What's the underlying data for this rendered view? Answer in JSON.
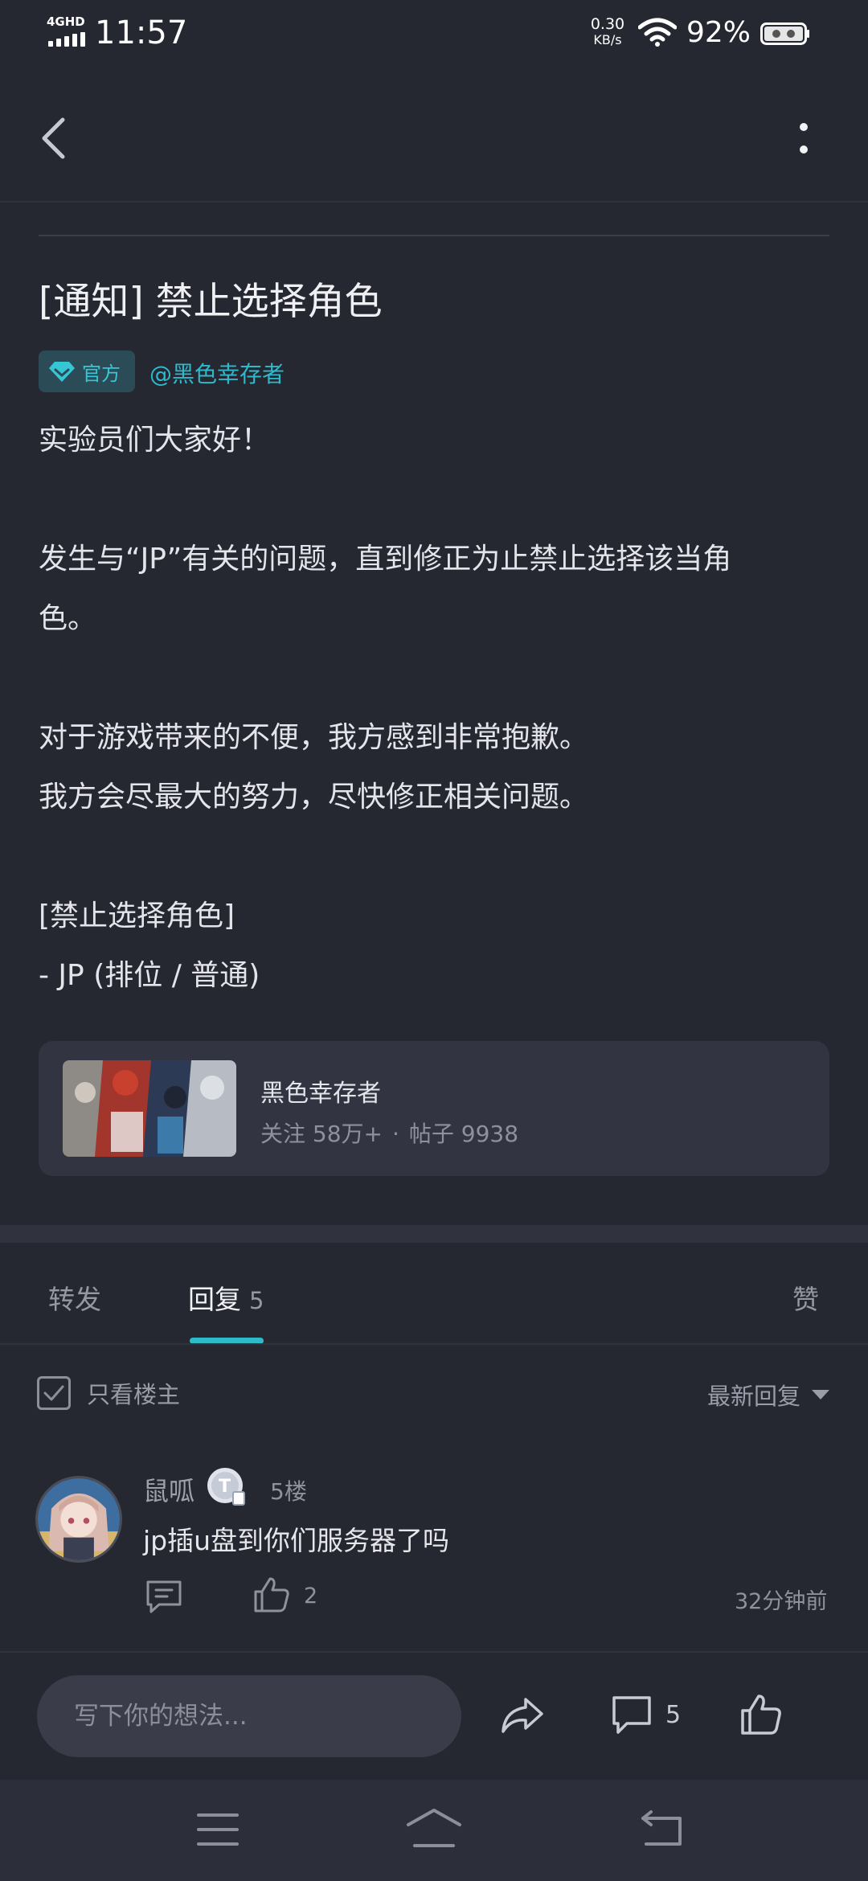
{
  "status_bar": {
    "network": "4GHD",
    "time": "11:57",
    "speed_value": "0.30",
    "speed_unit": "KB/s",
    "battery": "92%"
  },
  "post": {
    "title": "[通知] 禁止选择角色",
    "official_label": "官方",
    "author_tag": "@黑色幸存者",
    "body_lines": [
      "实验员们大家好！",
      "发生与“JP”有关的问题，直到修正为止禁止选择该当角",
      "色。",
      "对于游戏带来的不便，我方感到非常抱歉。",
      "我方会尽最大的努力，尽快修正相关问题。",
      "[禁止选择角色]",
      "- JP (排位 / 普通)"
    ]
  },
  "community": {
    "name": "黑色幸存者",
    "followers": "关注 58万+",
    "separator": "·",
    "posts": "帖子 9938"
  },
  "tabs": {
    "forward": "转发",
    "reply": "回复",
    "reply_count": "5",
    "like": "赞"
  },
  "filter": {
    "only_op": "只看楼主",
    "only_op_checked": true,
    "sort": "最新回复"
  },
  "comments": [
    {
      "user": "鼠呱",
      "floor": "5楼",
      "text": "jp插u盘到你们服务器了吗",
      "likes": "2",
      "time": "32分钟前"
    }
  ],
  "bottom_bar": {
    "input_placeholder": "写下你的想法...",
    "comment_count": "5"
  },
  "colors": {
    "background": "#252731",
    "accent": "#2dbbc9",
    "card": "#323541"
  },
  "icons": [
    "back-icon",
    "more-icon",
    "diamond-icon",
    "checkbox-icon",
    "reply-icon",
    "thumbs-up-icon",
    "share-icon",
    "comment-icon",
    "menu-icon",
    "home-icon",
    "return-icon"
  ]
}
